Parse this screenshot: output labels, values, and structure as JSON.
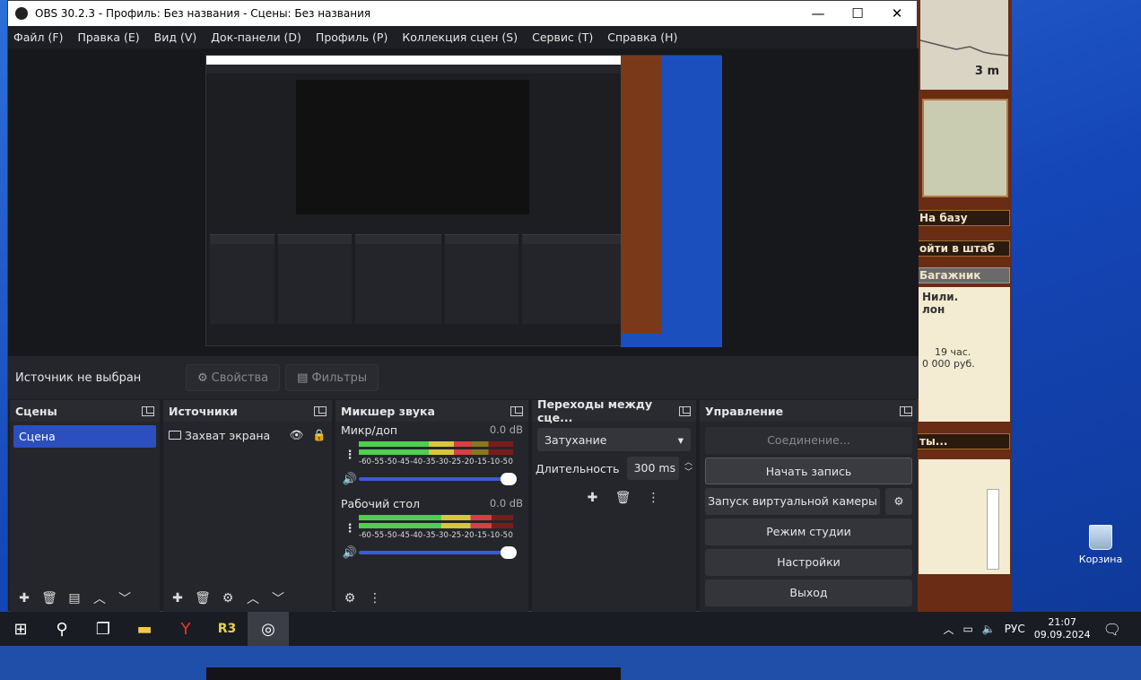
{
  "window": {
    "title": "OBS 30.2.3 - Профиль: Без названия - Сцены: Без названия",
    "minimize": "—",
    "maximize": "☐",
    "close": "✕"
  },
  "menu": [
    "Файл (F)",
    "Правка (E)",
    "Вид (V)",
    "Док-панели (D)",
    "Профиль (P)",
    "Коллекция сцен (S)",
    "Сервис (T)",
    "Справка (H)"
  ],
  "source_bar": {
    "no_source": "Источник не выбран",
    "properties": "Свойства",
    "filters": "Фильтры"
  },
  "scenes": {
    "title": "Сцены",
    "items": [
      "Сцена"
    ]
  },
  "sources": {
    "title": "Источники",
    "items": [
      "Захват экрана"
    ]
  },
  "mixer": {
    "title": "Микшер звука",
    "channels": [
      {
        "name": "Микр/доп",
        "db": "0.0 dB",
        "level": 0.73
      },
      {
        "name": "Рабочий стол",
        "db": "0.0 dB",
        "level": 0.86
      }
    ],
    "ticks": [
      "-60",
      "-55",
      "-50",
      "-45",
      "-40",
      "-35",
      "-30",
      "-25",
      "-20",
      "-15",
      "-10",
      "-5",
      "0"
    ]
  },
  "transitions": {
    "title": "Переходы между сце...",
    "selected": "Затухание",
    "duration_label": "Длительность",
    "duration_value": "300 ms"
  },
  "controls": {
    "title": "Управление",
    "connect": "Соединение...",
    "start_record": "Начать запись",
    "virtual_cam": "Запуск виртуальной камеры",
    "studio_mode": "Режим студии",
    "settings": "Настройки",
    "exit": "Выход"
  },
  "background_app": {
    "distance": "3 m",
    "btn1": "На базу",
    "btn2": "ойти в штаб",
    "btn3": "Багажник",
    "text1": "Нили.",
    "text2": "лон",
    "text3": "19 час.",
    "text4": "0 000 руб.",
    "text5": "ты..."
  },
  "desktop": {
    "recycle_bin": "Корзина"
  },
  "taskbar": {
    "lang": "РУС",
    "time": "21:07",
    "date": "09.09.2024"
  }
}
